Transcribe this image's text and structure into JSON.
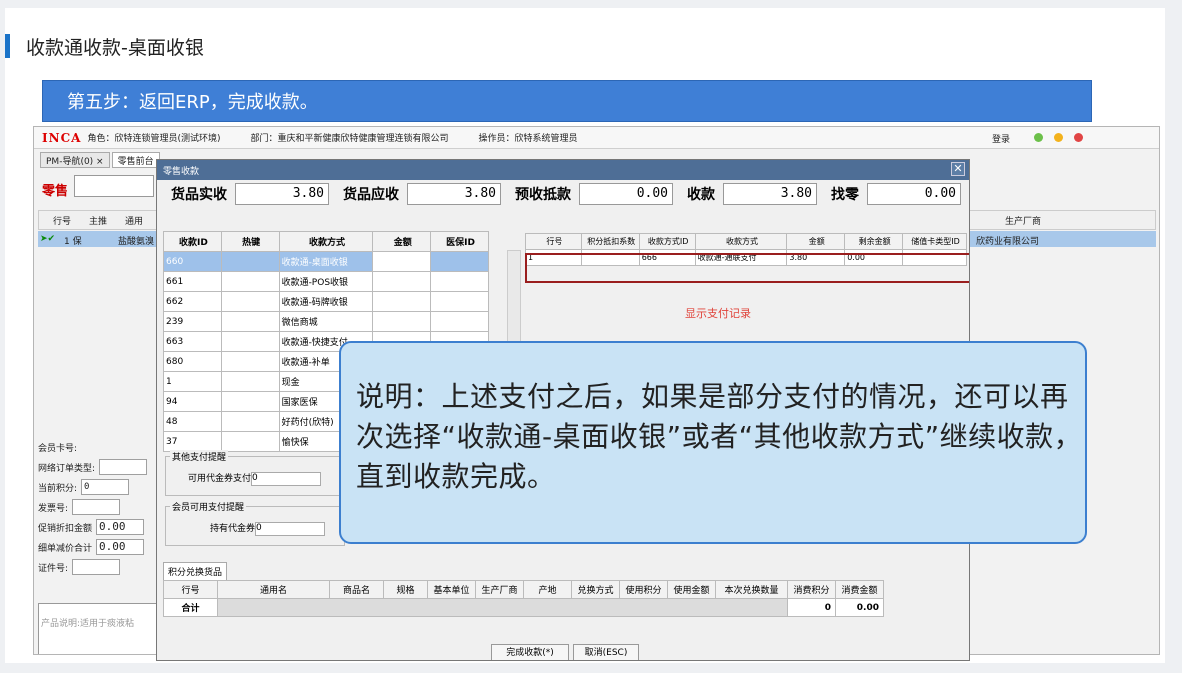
{
  "page": {
    "title": "收款通收款-桌面收银",
    "step": "第五步：返回ERP，完成收款。"
  },
  "erp": {
    "logo": "INCA",
    "role": "角色：欣特连锁管理员(测试环境)",
    "department": "部门：重庆和平新健康欣特健康管理连锁有限公司",
    "operator": "操作员：欣特系统管理员",
    "login": "登录",
    "tabs": [
      "PM-导航(0) ×",
      "零售前台"
    ],
    "sale_label": "零售",
    "grid_headers": {
      "row": "行号",
      "main": "主推",
      "generic": "通用",
      "maker": "生产厂商"
    },
    "grid_row": {
      "row": "1 保",
      "generic": "盐酸氨溴",
      "maker": "欣药业有限公司"
    },
    "left_form": [
      {
        "label": "会员卡号:",
        "value": ""
      },
      {
        "label": "网络订单类型:",
        "value": ""
      },
      {
        "label": "当前积分:",
        "value": "0"
      },
      {
        "label": "发票号:",
        "value": ""
      },
      {
        "label": "促销折扣金额",
        "value": "0.00"
      },
      {
        "label": "细单减价合计",
        "value": "0.00"
      },
      {
        "label": "证件号:",
        "value": ""
      }
    ],
    "product_desc": "产品说明:适用于痰液粘"
  },
  "dialog": {
    "title": "零售收款",
    "close": "✕",
    "summary": [
      {
        "label": "货品实收",
        "value": "3.80"
      },
      {
        "label": "货品应收",
        "value": "3.80"
      },
      {
        "label": "预收抵款",
        "value": "0.00"
      },
      {
        "label": "收款",
        "value": "3.80"
      },
      {
        "label": "找零",
        "value": "0.00"
      }
    ],
    "methods_headers": [
      "收款ID",
      "热键",
      "收款方式",
      "金额",
      "医保ID"
    ],
    "methods": [
      {
        "id": "660",
        "name": "收款通-桌面收银"
      },
      {
        "id": "661",
        "name": "收款通-POS收银"
      },
      {
        "id": "662",
        "name": "收款通-码牌收银"
      },
      {
        "id": "239",
        "name": "微信商城"
      },
      {
        "id": "663",
        "name": "收款通-快捷支付"
      },
      {
        "id": "680",
        "name": "收款通-补单"
      },
      {
        "id": "1",
        "name": "现金"
      },
      {
        "id": "94",
        "name": "国家医保"
      },
      {
        "id": "48",
        "name": "好药付(欣特)"
      },
      {
        "id": "37",
        "name": "愉快保"
      }
    ],
    "records_headers": [
      "行号",
      "积分抵扣系数",
      "收款方式ID",
      "收款方式",
      "金额",
      "剩余金额",
      "储值卡类型ID"
    ],
    "records": [
      {
        "row": "1",
        "coef": "",
        "method_id": "666",
        "method": "收款通-通联支付",
        "amount": "3.80",
        "remain": "0.00",
        "card": ""
      }
    ],
    "pay_record_label": "显示支付记录",
    "other_pay_hint": {
      "legend": "其他支付提醒",
      "label": "可用代金券支付",
      "value": "0"
    },
    "member_pay_hint": {
      "legend": "会员可用支付提醒",
      "label": "持有代金券",
      "value": "0"
    },
    "exchange_tab": "积分兑换货品",
    "exchange_headers": [
      "行号",
      "通用名",
      "商品名",
      "规格",
      "基本单位",
      "生产厂商",
      "产地",
      "兑换方式",
      "使用积分",
      "使用金额",
      "本次兑换数量",
      "消费积分",
      "消费金额"
    ],
    "exchange_total": {
      "label": "合计",
      "points": "0",
      "amount": "0.00"
    },
    "buttons": {
      "finish": "完成收款(*)",
      "cancel": "取消(ESC)"
    }
  },
  "note": {
    "text": "说明：上述支付之后，如果是部分支付的情况，还可以再次选择“收款通-桌面收银”或者“其他收款方式”继续收款，直到收款完成。"
  }
}
